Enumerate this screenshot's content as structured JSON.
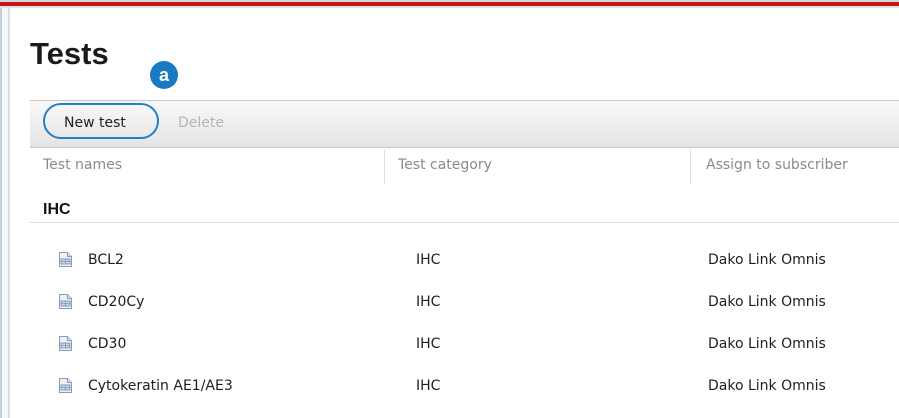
{
  "page": {
    "title": "Tests",
    "callout_label": "a"
  },
  "toolbar": {
    "new_test_label": "New test",
    "delete_label": "Delete"
  },
  "columns": {
    "test_names": "Test names",
    "test_category": "Test category",
    "assign_to_subscriber": "Assign to subscriber"
  },
  "group": {
    "label": "IHC"
  },
  "rows": [
    {
      "name": "BCL2",
      "category": "IHC",
      "subscriber": "Dako Link Omnis"
    },
    {
      "name": "CD20Cy",
      "category": "IHC",
      "subscriber": "Dako Link Omnis"
    },
    {
      "name": "CD30",
      "category": "IHC",
      "subscriber": "Dako Link Omnis"
    },
    {
      "name": "Cytokeratin AE1/AE3",
      "category": "IHC",
      "subscriber": "Dako Link Omnis"
    }
  ],
  "icons": {
    "row_icon": "test-document-icon"
  },
  "colors": {
    "accent_red": "#c01818",
    "callout_blue": "#1a79c3",
    "highlight_ring": "#1f80cc"
  }
}
